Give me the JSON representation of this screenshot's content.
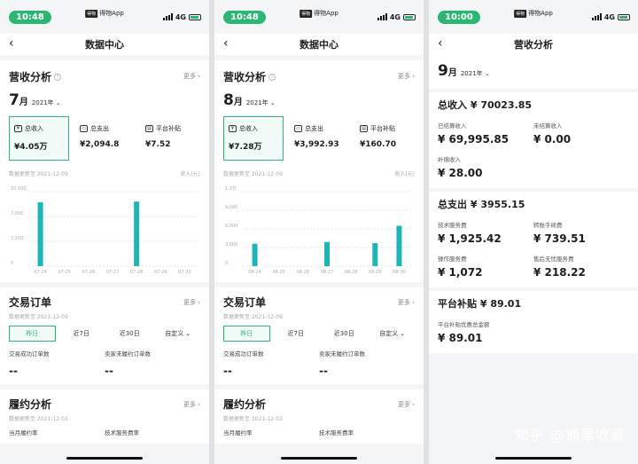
{
  "left": {
    "time": "10:48",
    "carrier": "得物App",
    "network": "4G",
    "nav_title": "数据中心",
    "rev_title": "营收分析",
    "more": "更多 ›",
    "month": "7",
    "month_unit": "月",
    "year": "2021年 ⌄",
    "stats": [
      {
        "label": "总收入",
        "value": "¥4.05万"
      },
      {
        "label": "总支出",
        "value": "¥2,094.8"
      },
      {
        "label": "平台补贴",
        "value": "¥7.52"
      }
    ],
    "updated": "数据更新至 2021-12-09",
    "unit": "收入(元)",
    "order_title": "交易订单",
    "order_updated": "数据更新至 2021-12-09",
    "tabs": [
      "昨日",
      "近7日",
      "近30日",
      "自定义 ⌄"
    ],
    "kv_labels": [
      "交易成功订单数",
      "卖家未履约订单数"
    ],
    "kv_values": [
      "--",
      "--"
    ],
    "perf_title": "履约分析",
    "perf_updated": "数据更新至 2021-12-02",
    "perf_labels": [
      "当月履约率",
      "技术服务费率"
    ]
  },
  "mid": {
    "time": "10:48",
    "carrier": "得物App",
    "network": "4G",
    "nav_title": "数据中心",
    "rev_title": "营收分析",
    "more": "更多 ›",
    "month": "8",
    "month_unit": "月",
    "year": "2021年 ⌄",
    "stats": [
      {
        "label": "总收入",
        "value": "¥7.28万"
      },
      {
        "label": "总支出",
        "value": "¥3,992.93"
      },
      {
        "label": "平台补贴",
        "value": "¥160.70"
      }
    ],
    "updated": "数据更新至 2021-12-09",
    "unit": "收入(元)",
    "order_title": "交易订单",
    "order_updated": "数据更新至 2021-12-09",
    "tabs": [
      "昨日",
      "近7日",
      "近30日",
      "自定义 ⌄"
    ],
    "kv_labels": [
      "交易成功订单数",
      "卖家未履约订单数"
    ],
    "kv_values": [
      "--",
      "--"
    ],
    "perf_title": "履约分析",
    "perf_updated": "数据更新至 2021-12-02",
    "perf_labels": [
      "当月履约率",
      "技术服务费率"
    ]
  },
  "right": {
    "time": "10:00",
    "carrier": "得物App",
    "network": "4G",
    "nav_title": "营收分析",
    "month": "9",
    "month_unit": "月",
    "year": "2021年 ⌄",
    "income_title": "总收入 ¥ 70023.85",
    "income": [
      {
        "k": "已结算收入",
        "v": "¥ 69,995.85"
      },
      {
        "k": "未结算收入",
        "v": "¥ 0.00"
      },
      {
        "k": "补偿收入",
        "v": "¥ 28.00"
      }
    ],
    "expense_title": "总支出 ¥ 3955.15",
    "expense": [
      {
        "k": "技术服务费",
        "v": "¥ 1,925.42"
      },
      {
        "k": "转账手续费",
        "v": "¥ 739.51"
      },
      {
        "k": "操作服务费",
        "v": "¥ 1,072"
      },
      {
        "k": "售后无忧服务费",
        "v": "¥ 218.22"
      }
    ],
    "subsidy_title": "平台补贴 ¥ 89.01",
    "subsidy": [
      {
        "k": "平台补贴优惠总金额",
        "v": "¥ 89.01"
      }
    ],
    "watermark": "知乎 @楠果收藏"
  },
  "chart_data": [
    {
      "type": "bar",
      "title": "",
      "ylabel": "收入(元)",
      "yticks": [
        "0",
        "3,500",
        "7,000",
        "10,500"
      ],
      "ylim": [
        0,
        10500
      ],
      "categories": [
        "07-24",
        "07-25",
        "07-26",
        "07-27",
        "07-28",
        "07-29",
        "07-30"
      ],
      "values": [
        9000,
        0,
        0,
        0,
        9100,
        0,
        0
      ],
      "color": "#1fb5b5"
    },
    {
      "type": "bar",
      "title": "",
      "ylabel": "收入(元)",
      "yticks": [
        "0",
        "3,000",
        "6,000",
        "9,000",
        "1.2万"
      ],
      "ylim": [
        0,
        12000
      ],
      "categories": [
        "08-24",
        "08-25",
        "08-26",
        "08-27",
        "08-28",
        "08-29",
        "08-30"
      ],
      "values": [
        3600,
        0,
        0,
        3900,
        0,
        3700,
        6500
      ],
      "color": "#1fb5b5"
    }
  ]
}
